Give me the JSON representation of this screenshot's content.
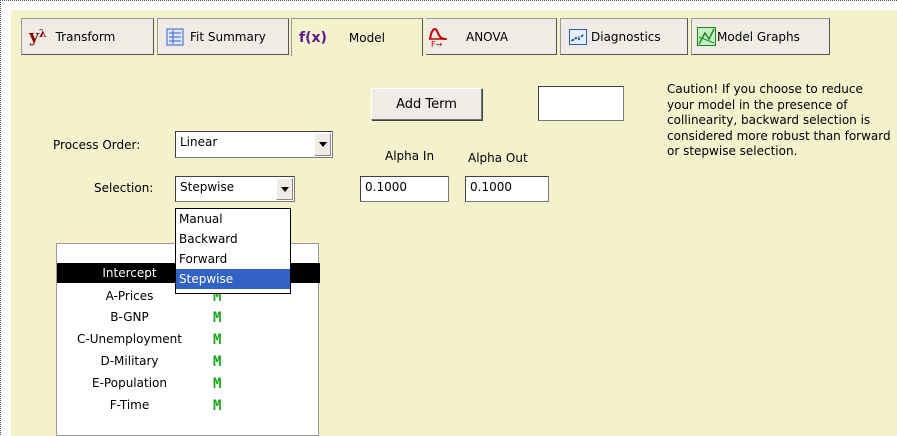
{
  "tabs": [
    {
      "label": "Transform",
      "icon": "lambda-icon"
    },
    {
      "label": "Fit Summary",
      "icon": "list-icon"
    },
    {
      "label": "Model",
      "icon": "fx-icon"
    },
    {
      "label": "ANOVA",
      "icon": "f-distribution-icon"
    },
    {
      "label": "Diagnostics",
      "icon": "scatter-plot-icon"
    },
    {
      "label": "Model Graphs",
      "icon": "graph-icon"
    }
  ],
  "icon_text": {
    "transform": "y",
    "transform_sup": "λ",
    "model": "f(x)"
  },
  "active_tab": "Model",
  "controls": {
    "add_term_label": "Add Term",
    "add_term_value": "",
    "process_order_label": "Process Order:",
    "process_order_value": "Linear",
    "selection_label": "Selection:",
    "selection_value": "Stepwise",
    "alpha_in_label": "Alpha In",
    "alpha_in_value": "0.1000",
    "alpha_out_label": "Alpha Out",
    "alpha_out_value": "0.1000"
  },
  "selection_options": [
    "Manual",
    "Backward",
    "Forward",
    "Stepwise"
  ],
  "caution_text": "Caution!  If you choose to reduce your model in the presence of collinearity, backward selection is considered more robust than forward or stepwise selection.",
  "factors": [
    {
      "name": "Intercept",
      "mark": ""
    },
    {
      "name": "A-Prices",
      "mark": "M"
    },
    {
      "name": "B-GNP",
      "mark": "M"
    },
    {
      "name": "C-Unemployment",
      "mark": "M"
    },
    {
      "name": "D-Military",
      "mark": "M"
    },
    {
      "name": "E-Population",
      "mark": "M"
    },
    {
      "name": "F-Time",
      "mark": "M"
    }
  ],
  "colors": {
    "panel": "#f4f1cd",
    "selection_highlight": "#3163c6",
    "mark": "#1aa51a"
  }
}
